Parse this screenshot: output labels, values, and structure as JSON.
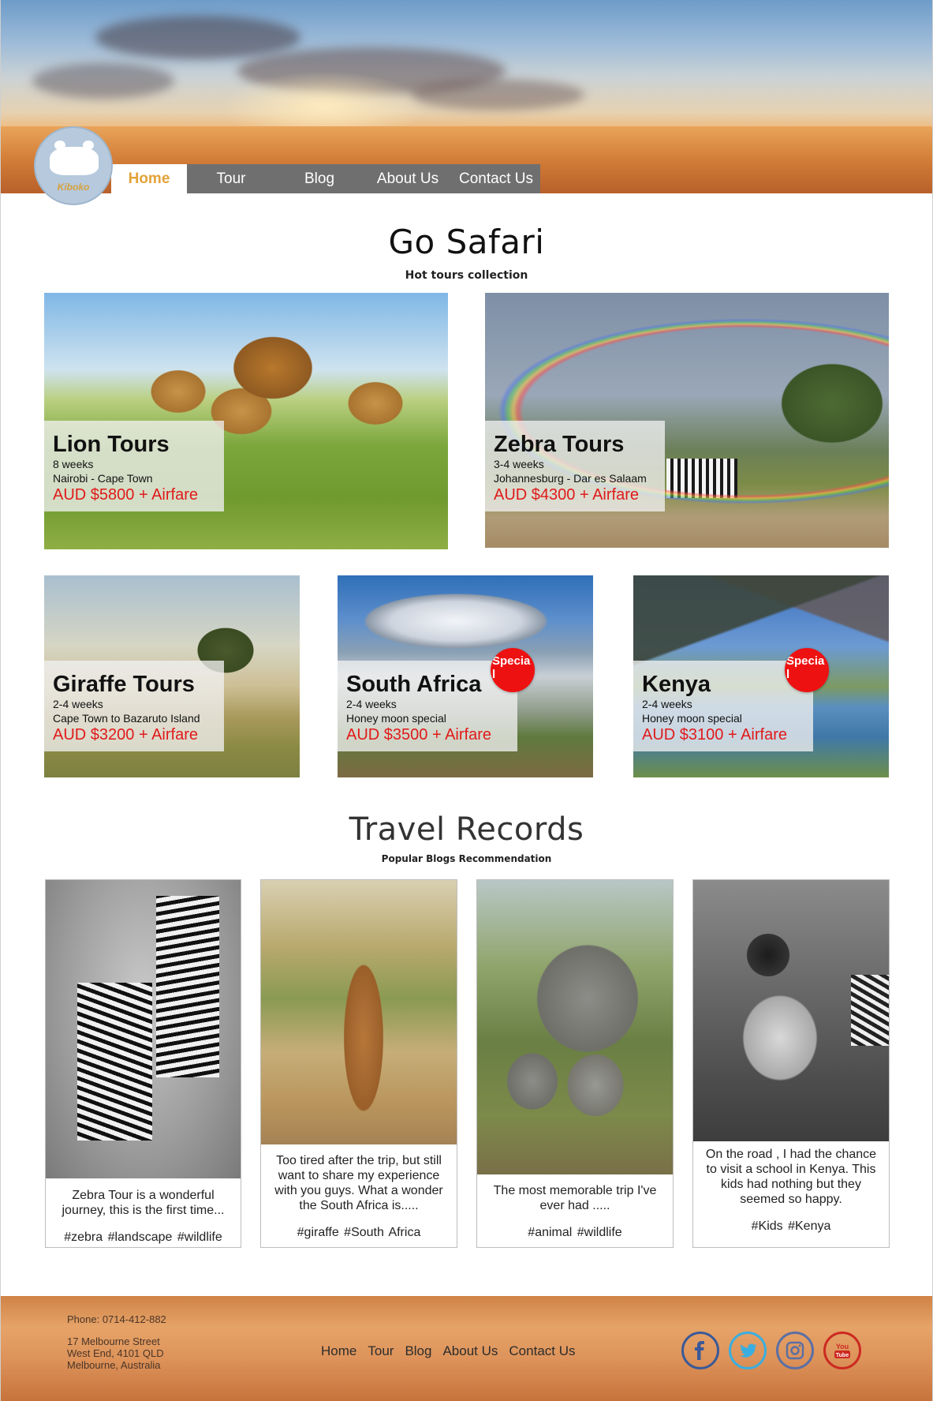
{
  "brand": {
    "logo_text": "Kiboko"
  },
  "nav": {
    "items": [
      {
        "label": "Home",
        "active": true
      },
      {
        "label": "Tour",
        "active": false
      },
      {
        "label": "Blog",
        "active": false
      },
      {
        "label": "About Us",
        "active": false
      },
      {
        "label": "Contact Us",
        "active": false
      }
    ]
  },
  "tours_section": {
    "title": "Go Safari",
    "subtitle": "Hot tours collection"
  },
  "tours": [
    {
      "title": "Lion Tours",
      "duration": "8 weeks",
      "route": "Nairobi - Cape Town",
      "price": "AUD $5800 + Airfare"
    },
    {
      "title": "Zebra Tours",
      "duration": "3-4 weeks",
      "route": "Johannesburg - Dar es Salaam",
      "price": "AUD $4300 + Airfare"
    },
    {
      "title": "Giraffe Tours",
      "duration": "2-4 weeks",
      "route": "Cape Town to Bazaruto Island",
      "price": "AUD $3200 + Airfare"
    },
    {
      "title": "South Africa",
      "duration": "2-4 weeks",
      "route": "Honey moon special",
      "price": "AUD $3500 + Airfare",
      "badge": "Specia\nl"
    },
    {
      "title": "Kenya",
      "duration": "2-4 weeks",
      "route": "Honey moon special",
      "price": "AUD $3100 + Airfare",
      "badge": "Specia\nl"
    }
  ],
  "blog_section": {
    "title": "Travel Records",
    "subtitle": "Popular Blogs Recommendation"
  },
  "blogs": [
    {
      "text": "Zebra Tour is a wonderful journey, this is the first time...",
      "tags": "#zebra  #landscape  #wildlife"
    },
    {
      "text": "Too tired after the trip, but still want to share my experience with you guys. What a wonder the South Africa is.....",
      "tags": "#giraffe  #South  Africa"
    },
    {
      "text": "The most memorable trip I've ever had .....",
      "tags": "#animal  #wildlife"
    },
    {
      "text": "On the road , I had the chance to visit a school in Kenya. This kids had nothing but they seemed so happy.",
      "tags": "#Kids  #Kenya"
    }
  ],
  "footer": {
    "phone": "Phone: 0714-412-882",
    "address_line1": "17 Melbourne Street",
    "address_line2": "West End, 4101 QLD",
    "address_line3": "Melbourne, Australia",
    "nav": [
      "Home",
      "Tour",
      "Blog",
      "About Us",
      "Contact Us"
    ],
    "social": [
      {
        "name": "facebook-icon",
        "color": "#3b5998"
      },
      {
        "name": "twitter-icon",
        "color": "#3aaee0"
      },
      {
        "name": "instagram-icon",
        "color": "#5c6fa3"
      },
      {
        "name": "youtube-icon",
        "color": "#cc2a22",
        "label": "You Tube"
      }
    ]
  },
  "colors": {
    "accent": "#e3a33a",
    "price": "#e01a1a",
    "nav_bg": "#6f6f6f",
    "badge": "#ee1111"
  }
}
